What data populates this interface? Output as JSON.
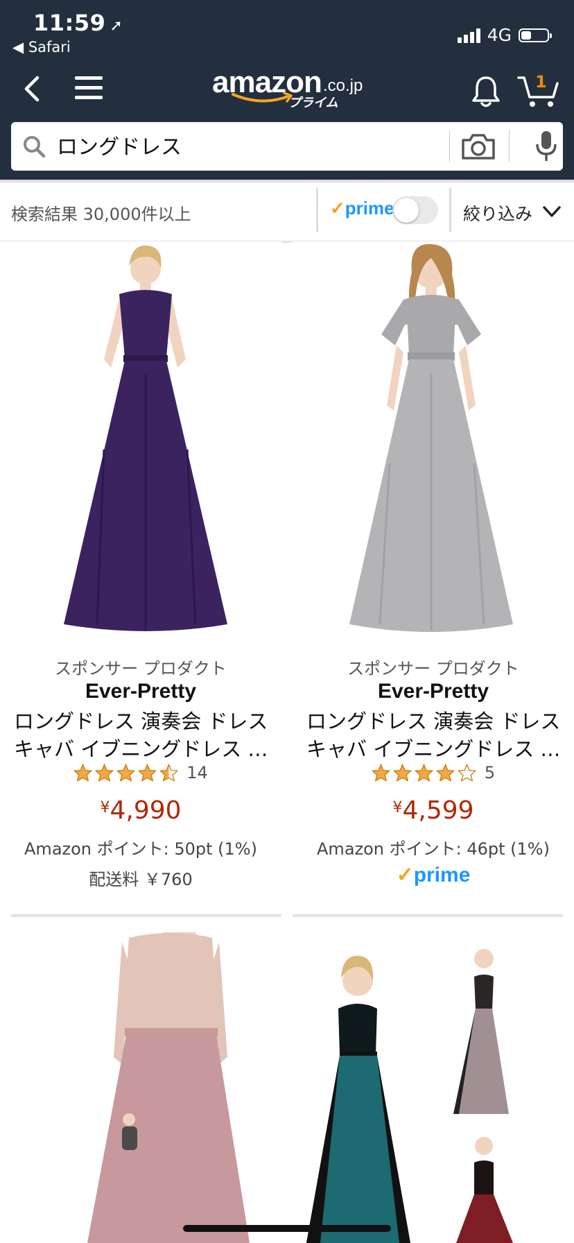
{
  "status_bar": {
    "time": "11:59",
    "back_app": "◀ Safari",
    "network": "4G"
  },
  "header": {
    "logo_word": "amazon",
    "logo_tld": ".co.jp",
    "logo_sub": "プライム",
    "cart_count": "1"
  },
  "search": {
    "query": "ロングドレス"
  },
  "results_bar": {
    "count_text": "検索結果 30,000件以上",
    "prime_label": "prime",
    "prime_check": "✓",
    "filter_label": "絞り込み"
  },
  "products": [
    {
      "sponsored": "スポンサー プロダクト",
      "brand": "Ever-Pretty",
      "title_line1": "ロングドレス 演奏会 ドレス",
      "title_line2": "キャバ イブニングドレス …",
      "stars": 4.5,
      "review_count": "14",
      "price_symbol": "¥",
      "price": "4,990",
      "points": "Amazon ポイント: 50pt (1%)",
      "shipping": "配送料 ￥760",
      "dress_color": "#3b2360"
    },
    {
      "sponsored": "スポンサー プロダクト",
      "brand": "Ever-Pretty",
      "title_line1": "ロングドレス 演奏会 ドレス",
      "title_line2": "キャバ イブニングドレス …",
      "stars": 4,
      "review_count": "5",
      "price_symbol": "¥",
      "price": "4,599",
      "points": "Amazon ポイント: 46pt (1%)",
      "prime_label": "prime",
      "prime_check": "✓",
      "dress_color": "#b4b4b6"
    }
  ],
  "colors": {
    "header_bg": "#232f3e",
    "price": "#b12704",
    "prime_blue": "#1a98ff",
    "prime_check": "#f4a21b",
    "cart_badge": "#f08804"
  }
}
